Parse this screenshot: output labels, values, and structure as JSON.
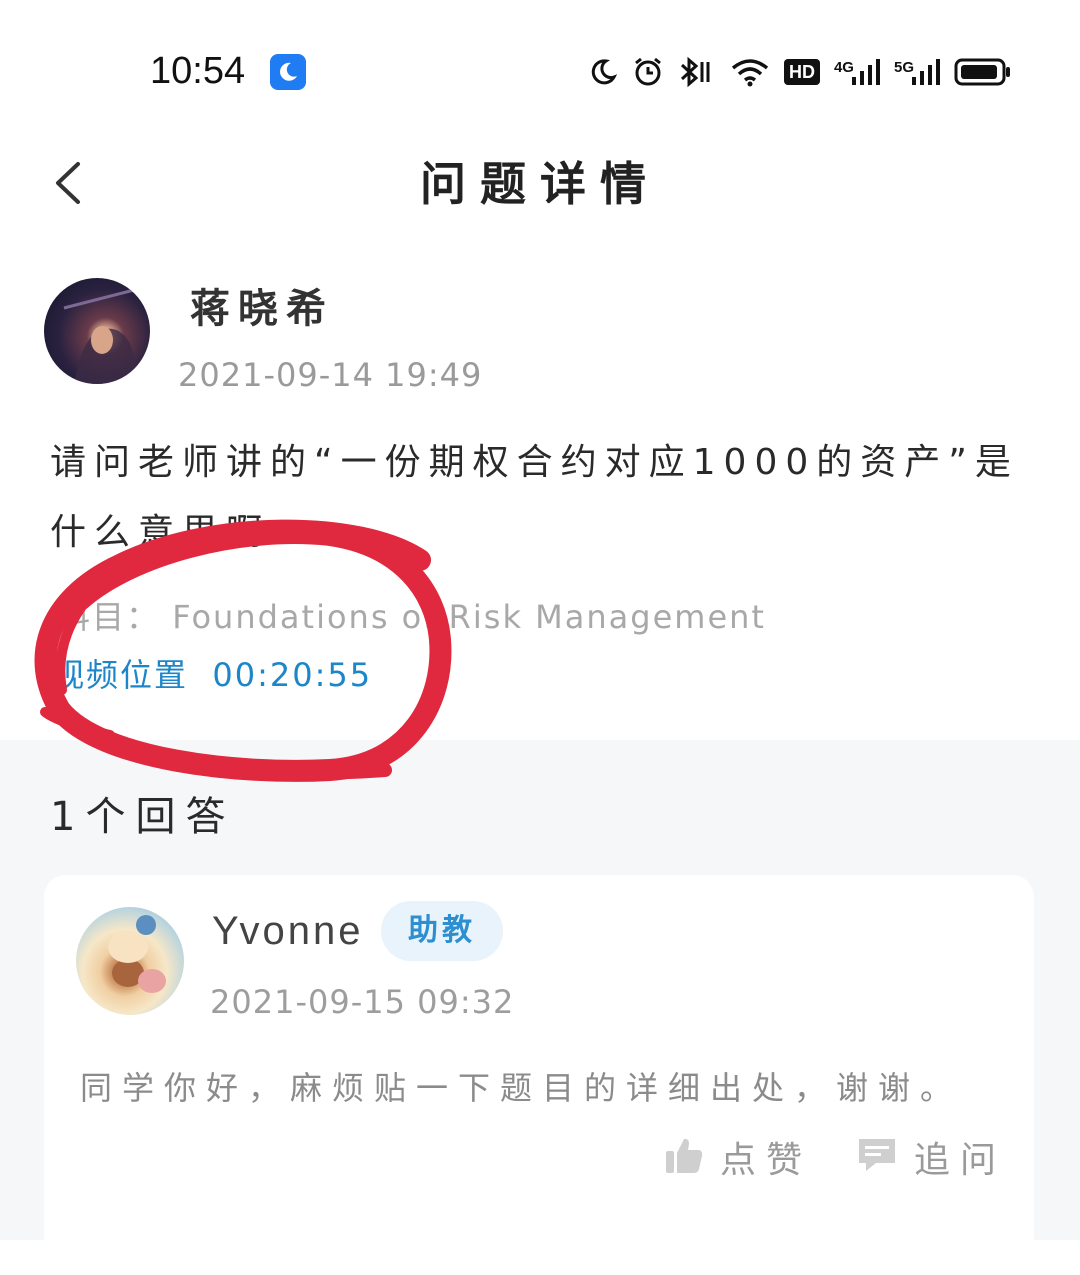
{
  "status_bar": {
    "time": "10:54",
    "hd_label": "HD",
    "net1_label": "4G",
    "net2_label": "5G",
    "icons": [
      "moon-icon",
      "alarm-icon",
      "bluetooth-icon",
      "wifi-icon",
      "hd-icon",
      "signal-4g-icon",
      "signal-5g-icon",
      "battery-icon"
    ]
  },
  "header": {
    "title": "问题详情",
    "back_icon": "chevron-left-icon"
  },
  "question": {
    "author": "蒋晓希",
    "time": "2021-09-14 19:49",
    "text": "请问老师讲的“一份期权合约对应1000的资产”是什么意思啊",
    "course_label": "科目：",
    "course": "Foundations of Risk Management",
    "video_label": "视频位置",
    "video_time": "00:20:55"
  },
  "answers": {
    "count_label": "1个回答",
    "items": [
      {
        "name": "Yvonne",
        "badge": "助教",
        "time": "2021-09-15 09:32",
        "text": "同学你好，麻烦贴一下题目的详细出处，谢谢。",
        "like_label": "点赞",
        "followup_label": "追问"
      }
    ]
  },
  "colors": {
    "accent_blue": "#1d86c8",
    "badge_bg": "#e9f3fb",
    "annotation_red": "#e0283e",
    "section_bg": "#f6f7f9"
  }
}
